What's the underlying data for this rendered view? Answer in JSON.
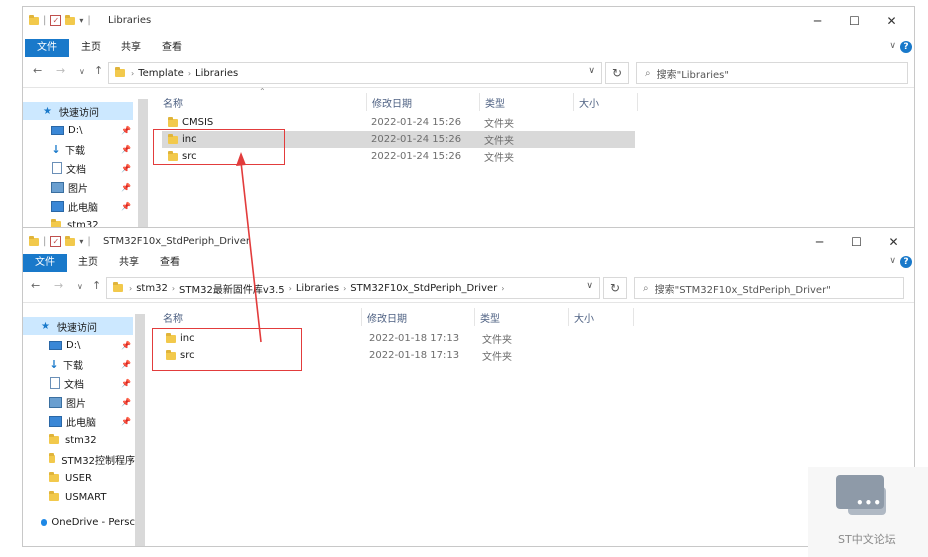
{
  "top_window": {
    "title": "Libraries",
    "ribbon_tabs": [
      "文件",
      "主页",
      "共享",
      "查看"
    ],
    "breadcrumb": [
      "Template",
      "Libraries"
    ],
    "search_placeholder": "搜索\"Libraries\"",
    "columns": [
      "名称",
      "修改日期",
      "类型",
      "大小"
    ],
    "sidebar": [
      {
        "label": "快速访问",
        "icon": "star-icon"
      },
      {
        "label": "D:\\",
        "icon": "drive-icon",
        "pinned": true
      },
      {
        "label": "下载",
        "icon": "download-icon",
        "pinned": true
      },
      {
        "label": "文档",
        "icon": "document-icon",
        "pinned": true
      },
      {
        "label": "图片",
        "icon": "picture-icon",
        "pinned": true
      },
      {
        "label": "此电脑",
        "icon": "computer-icon",
        "pinned": true
      },
      {
        "label": "stm32",
        "icon": "folder-icon"
      }
    ],
    "files": [
      {
        "name": "CMSIS",
        "date": "2022-01-24 15:26",
        "type": "文件夹",
        "size": ""
      },
      {
        "name": "inc",
        "date": "2022-01-24 15:26",
        "type": "文件夹",
        "size": "",
        "selected": true
      },
      {
        "name": "src",
        "date": "2022-01-24 15:26",
        "type": "文件夹",
        "size": ""
      }
    ]
  },
  "bottom_window": {
    "title": "STM32F10x_StdPeriph_Driver",
    "ribbon_tabs": [
      "文件",
      "主页",
      "共享",
      "查看"
    ],
    "breadcrumb": [
      "stm32",
      "STM32最新固件库v3.5",
      "Libraries",
      "STM32F10x_StdPeriph_Driver"
    ],
    "search_placeholder": "搜索\"STM32F10x_StdPeriph_Driver\"",
    "columns": [
      "名称",
      "修改日期",
      "类型",
      "大小"
    ],
    "sidebar": [
      {
        "label": "快速访问",
        "icon": "star-icon"
      },
      {
        "label": "D:\\",
        "icon": "drive-icon",
        "pinned": true
      },
      {
        "label": "下载",
        "icon": "download-icon",
        "pinned": true
      },
      {
        "label": "文档",
        "icon": "document-icon",
        "pinned": true
      },
      {
        "label": "图片",
        "icon": "picture-icon",
        "pinned": true
      },
      {
        "label": "此电脑",
        "icon": "computer-icon",
        "pinned": true
      },
      {
        "label": "stm32",
        "icon": "folder-icon"
      },
      {
        "label": "STM32控制程序",
        "icon": "folder-icon"
      },
      {
        "label": "USER",
        "icon": "folder-icon"
      },
      {
        "label": "USMART",
        "icon": "folder-icon"
      },
      {
        "label": "OneDrive - Persc",
        "icon": "onedrive-icon"
      }
    ],
    "files": [
      {
        "name": "inc",
        "date": "2022-01-18 17:13",
        "type": "文件夹",
        "size": ""
      },
      {
        "name": "src",
        "date": "2022-01-18 17:13",
        "type": "文件夹",
        "size": ""
      }
    ]
  },
  "watermark": {
    "text": "ST中文论坛"
  },
  "annotation_color": "#e23c3c",
  "accent_color": "#1979ca"
}
